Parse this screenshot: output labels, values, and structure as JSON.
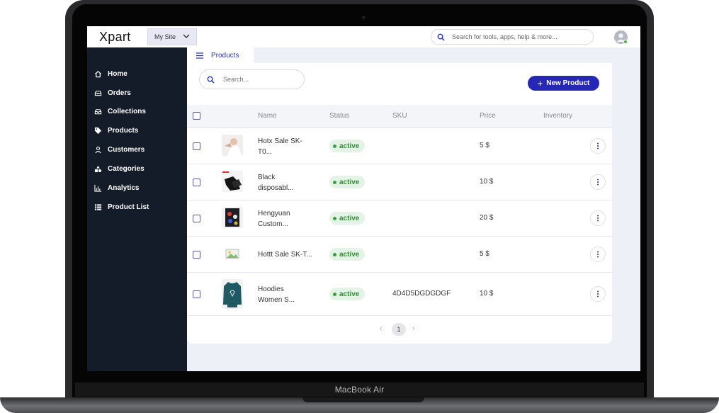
{
  "device": {
    "model_label": "MacBook Air"
  },
  "topbar": {
    "logo": "Xpart",
    "site_selector": "My Site",
    "search_placeholder": "Search for tools, apps, help & more..."
  },
  "sidebar": {
    "items": [
      {
        "label": "Home",
        "icon": "home-icon"
      },
      {
        "label": "Orders",
        "icon": "inbox-icon"
      },
      {
        "label": "Collections",
        "icon": "inbox-icon"
      },
      {
        "label": "Products",
        "icon": "tag-icon"
      },
      {
        "label": "Customers",
        "icon": "user-icon"
      },
      {
        "label": "Categories",
        "icon": "shapes-icon"
      },
      {
        "label": "Analytics",
        "icon": "bar-chart-icon"
      },
      {
        "label": "Product List",
        "icon": "list-icon"
      }
    ]
  },
  "tab": {
    "label": "Products"
  },
  "products_card": {
    "search_placeholder": "Search...",
    "new_button": "New Product",
    "columns": [
      "Name",
      "Status",
      "SKU",
      "Price",
      "Inventory"
    ],
    "rows": [
      {
        "name_line1": "Hotx Sale SK-",
        "name_line2": "T0...",
        "status": "active",
        "sku": "",
        "price": "5 $",
        "thumb": "woman-photo"
      },
      {
        "name_line1": "Black",
        "name_line2": "disposabl...",
        "status": "active",
        "sku": "",
        "price": "10 $",
        "thumb": "black-gloves"
      },
      {
        "name_line1": "Hengyuan",
        "name_line2": "Custom...",
        "status": "active",
        "sku": "",
        "price": "20 $",
        "thumb": "printed-shirt"
      },
      {
        "name_line1": "Hottt Sale SK-T...",
        "name_line2": "",
        "status": "active",
        "sku": "",
        "price": "5 $",
        "thumb": "image-placeholder"
      },
      {
        "name_line1": "Hoodies",
        "name_line2": "Women S...",
        "status": "active",
        "sku": "4D4D5DGDGDGF",
        "price": "10 $",
        "thumb": "teal-hoodie"
      }
    ],
    "pagination": {
      "prev": "‹",
      "current": "1",
      "next": "›"
    }
  },
  "colors": {
    "sidebar_bg": "#141c29",
    "accent": "#2627b5",
    "status_active": "#2f8f38",
    "status_active_bg": "#e4f3e5"
  }
}
